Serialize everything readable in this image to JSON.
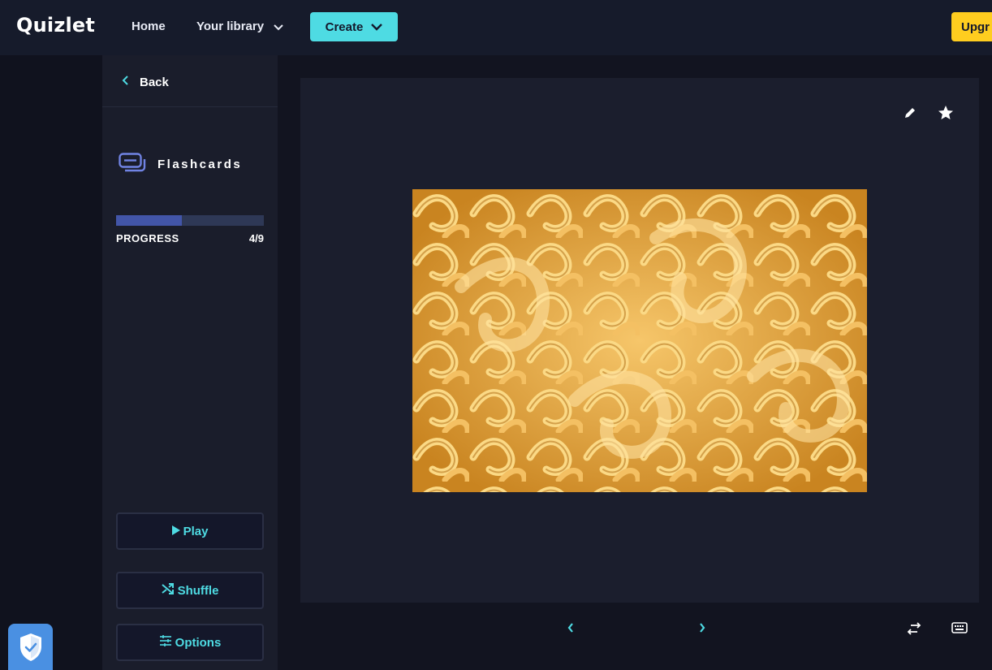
{
  "header": {
    "logo": "Quizlet",
    "nav_home": "Home",
    "nav_library": "Your library",
    "create_label": "Create",
    "upgrade_label": "Upgr"
  },
  "sidebar": {
    "back_label": "Back",
    "mode_label": "Flashcards",
    "progress_label": "PROGRESS",
    "progress_count": "4/9",
    "progress_fraction": 0.444,
    "play_label": "Play",
    "shuffle_label": "Shuffle",
    "options_label": "Options"
  },
  "card": {
    "image_subject": "rotini pasta photo",
    "icons": [
      "edit-icon",
      "star-icon"
    ]
  },
  "controls": {
    "icons": [
      "chevron-left-icon",
      "chevron-right-icon",
      "swap-icon",
      "keyboard-icon"
    ]
  },
  "colors": {
    "accent": "#4edbe3",
    "upgrade": "#ffcd1f",
    "progress": "#4255a8",
    "shield": "#4a90e2"
  }
}
